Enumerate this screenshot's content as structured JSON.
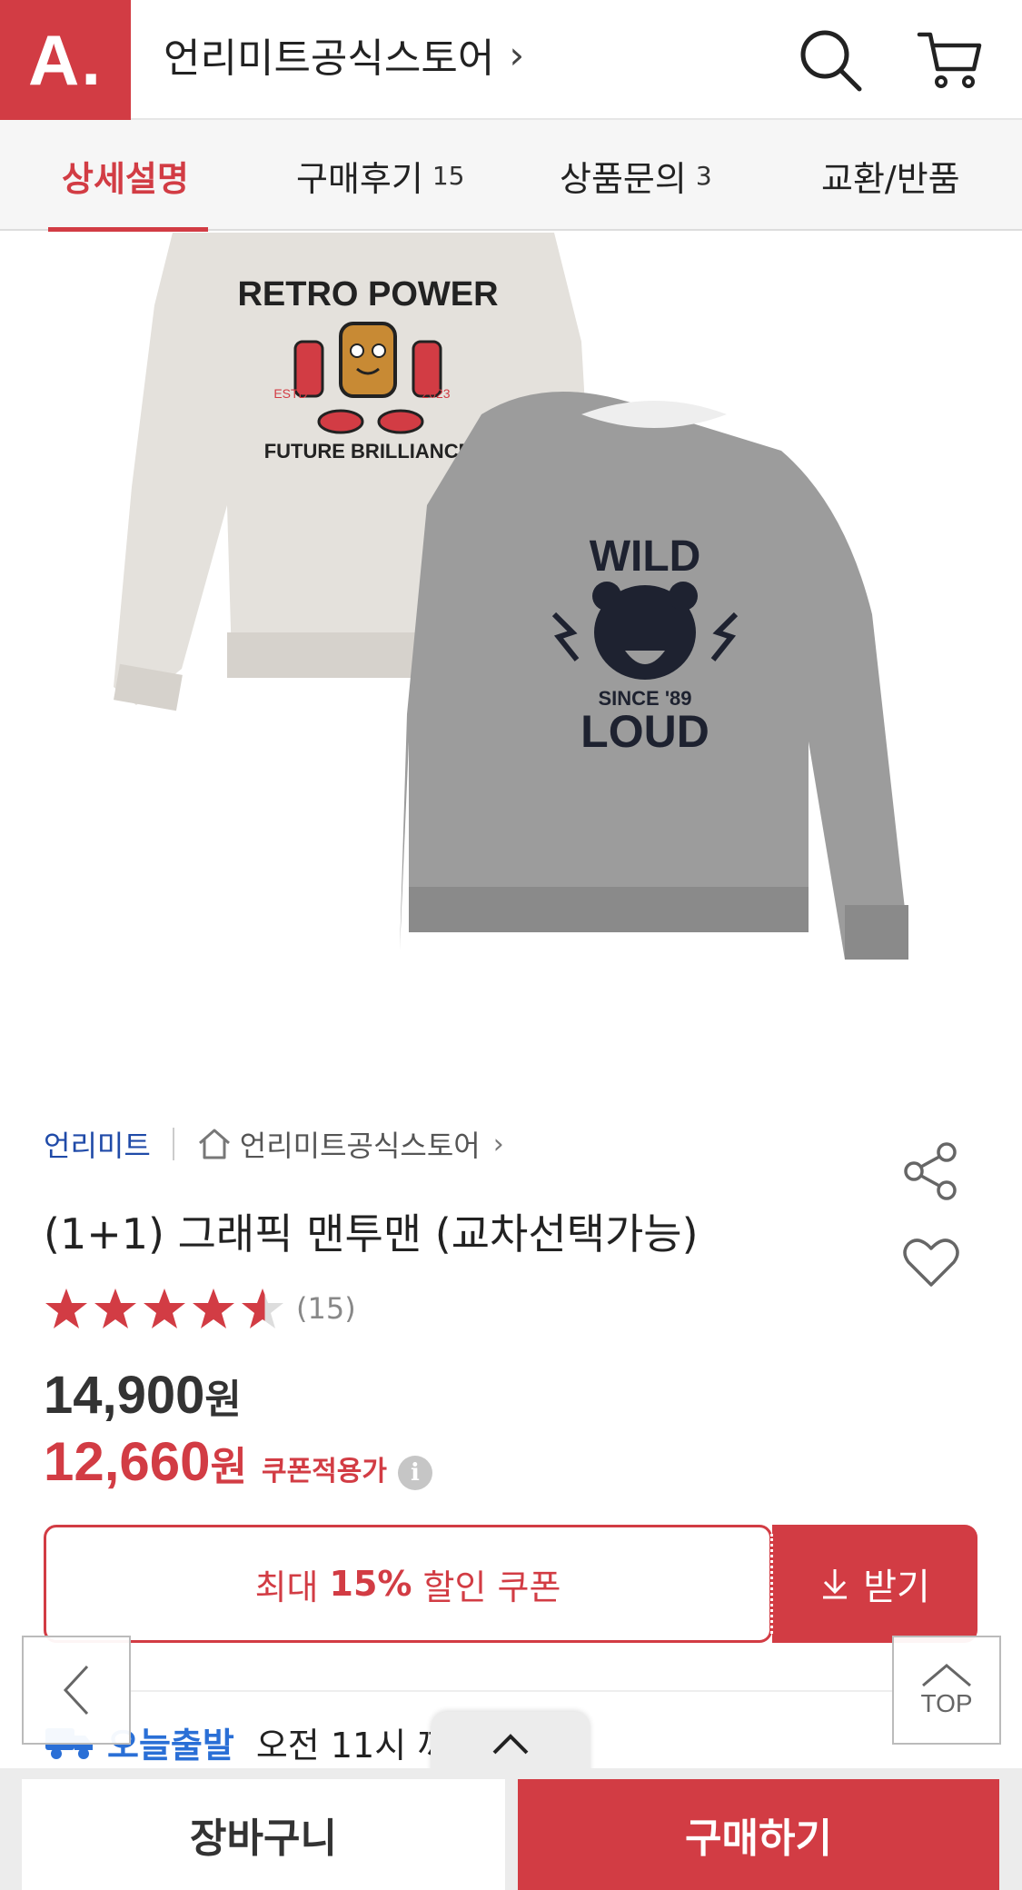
{
  "header": {
    "logo": "A.",
    "store_title": "언리미트공식스토어",
    "chevron": "›"
  },
  "tabs": [
    {
      "label": "상세설명",
      "count": ""
    },
    {
      "label": "구매후기",
      "count": "15"
    },
    {
      "label": "상품문의",
      "count": "3"
    },
    {
      "label": "교환/반품",
      "count": ""
    }
  ],
  "product_image": {
    "left_shirt": {
      "line1": "RETRO POWER",
      "estd": "ESTD",
      "year": "2023",
      "line2": "FUTURE BRILLIANCE"
    },
    "right_shirt": {
      "line1": "WILD",
      "since": "SINCE '89",
      "line2": "LOUD"
    }
  },
  "product": {
    "brand": "언리미트",
    "store": "언리미트공식스토어",
    "name": "(1+1) 그래픽 맨투맨 (교차선택가능)",
    "rating": 4.5,
    "review_count": "(15)",
    "price_original": "14,900",
    "price_sale": "12,660",
    "won": "원",
    "coupon_note": "쿠폰적용가"
  },
  "coupon": {
    "prefix": "최대",
    "percent": "15%",
    "suffix": "할인 쿠폰",
    "get_label": "받기"
  },
  "delivery": {
    "tag": "오늘출발",
    "text": "오전 11시 까"
  },
  "nav": {
    "top_label": "TOP"
  },
  "bottom": {
    "cart_label": "장바구니",
    "buy_label": "구매하기"
  },
  "colors": {
    "accent": "#d23c44",
    "brand_link": "#1f4aa8",
    "delivery": "#2a6fd6"
  }
}
